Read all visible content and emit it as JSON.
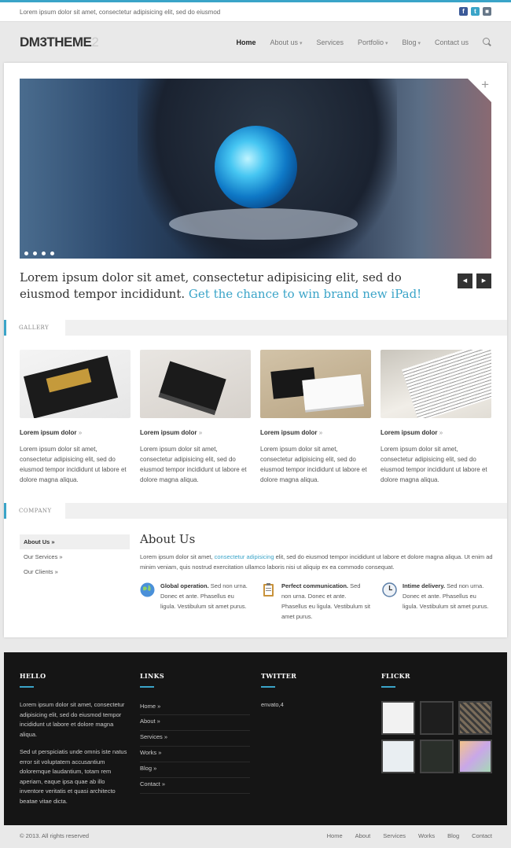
{
  "topbar": {
    "tagline": "Lorem ipsum dolor sit amet, consectetur adipisicing elit, sed do eiusmod"
  },
  "social": [
    {
      "icon": "facebook-icon",
      "glyph": "f",
      "color": "#3b5998"
    },
    {
      "icon": "twitter-icon",
      "glyph": "t",
      "color": "#3aa4c8"
    },
    {
      "icon": "rss-icon",
      "glyph": "■",
      "color": "#667788"
    }
  ],
  "logo": {
    "main": "DM3THEME",
    "suffix": "2"
  },
  "nav": {
    "items": [
      {
        "label": "Home",
        "active": true,
        "dropdown": false
      },
      {
        "label": "About us",
        "active": false,
        "dropdown": true
      },
      {
        "label": "Services",
        "active": false,
        "dropdown": false
      },
      {
        "label": "Portfolio",
        "active": false,
        "dropdown": true
      },
      {
        "label": "Blog",
        "active": false,
        "dropdown": true
      },
      {
        "label": "Contact us",
        "active": false,
        "dropdown": false
      }
    ],
    "search_icon": "search-icon"
  },
  "slider": {
    "dots": 4,
    "expand_icon": "plus-icon",
    "expand_glyph": "+"
  },
  "intro": {
    "text": "Lorem ipsum dolor sit amet, consectetur adipisicing elit, sed do eiusmod tempor incididunt.",
    "highlight": "Get the chance to win brand new iPad!"
  },
  "arrows": {
    "prev": "◀",
    "next": "▶"
  },
  "gallery": {
    "label": "GALLERY",
    "items": [
      {
        "title": "Lorem ipsum dolor",
        "arrow": "»",
        "desc": "Lorem ipsum dolor sit amet, consectetur adipisicing elit, sed do eiusmod tempor incididunt ut labore et dolore magna aliqua."
      },
      {
        "title": "Lorem ipsum dolor",
        "arrow": "»",
        "desc": "Lorem ipsum dolor sit amet, consectetur adipisicing elit, sed do eiusmod tempor incididunt ut labore et dolore magna aliqua."
      },
      {
        "title": "Lorem ipsum dolor",
        "arrow": "»",
        "desc": "Lorem ipsum dolor sit amet, consectetur adipisicing elit, sed do eiusmod tempor incididunt ut labore et dolore magna aliqua."
      },
      {
        "title": "Lorem ipsum dolor",
        "arrow": "»",
        "desc": "Lorem ipsum dolor sit amet, consectetur adipisicing elit, sed do eiusmod tempor incididunt ut labore et dolore magna aliqua."
      }
    ]
  },
  "company": {
    "label": "COMPANY",
    "sidebar": [
      {
        "label": "About Us »",
        "active": true
      },
      {
        "label": "Our Services »",
        "active": false
      },
      {
        "label": "Our Clients »",
        "active": false
      }
    ],
    "title": "About Us",
    "text_before": "Lorem ipsum dolor sit amet, ",
    "text_link": "consectetur adipisicing",
    "text_after": " elit, sed do eiusmod tempor incididunt ut labore et dolore magna aliqua. Ut enim ad minim veniam, quis nostrud exercitation ullamco laboris nisi ut aliquip ex ea commodo consequat.",
    "features": [
      {
        "icon": "globe-icon",
        "title": "Global operation.",
        "text": "Sed non urna. Donec et ante. Phasellus eu ligula. Vestibulum sit amet purus."
      },
      {
        "icon": "clipboard-icon",
        "title": "Perfect communication.",
        "text": "Sed non urna. Donec et ante. Phasellus eu ligula. Vestibulum sit amet purus."
      },
      {
        "icon": "clock-icon",
        "title": "Intime delivery.",
        "text": "Sed non urna. Donec et ante. Phasellus eu ligula. Vestibulum sit amet purus."
      }
    ]
  },
  "footer": {
    "hello": {
      "title": "HELLO",
      "p1": "Lorem ipsum dolor sit amet, consectetur adipisicing elit, sed do eiusmod tempor incididunt ut labore et dolore magna aliqua.",
      "p2": "Sed ut perspiciatis unde omnis iste natus error sit voluptatem accusantium doloremque laudantium, totam rem aperiam, eaque ipsa quae ab illo inventore veritatis et quasi architecto beatae vitae dicta."
    },
    "links": {
      "title": "LINKS",
      "items": [
        "Home »",
        "About »",
        "Services »",
        "Works »",
        "Blog »",
        "Contact »"
      ]
    },
    "twitter": {
      "title": "TWITTER",
      "text": "envato,4"
    },
    "flickr": {
      "title": "FLICKR",
      "count": 6
    }
  },
  "bottom": {
    "copyright": "© 2013. All rights reserved",
    "links": [
      "Home",
      "About",
      "Services",
      "Works",
      "Blog",
      "Contact"
    ]
  }
}
